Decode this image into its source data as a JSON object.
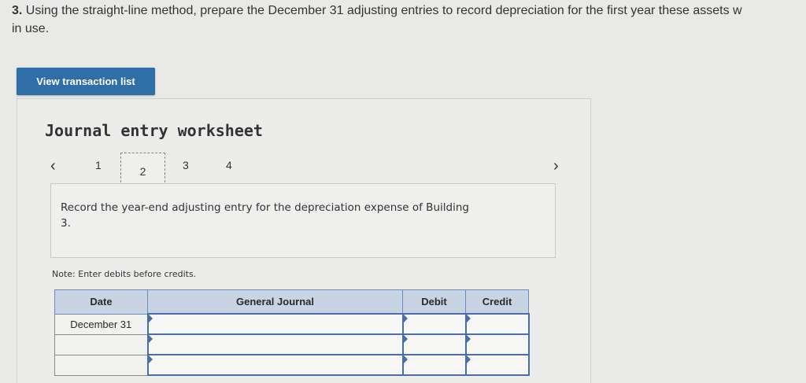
{
  "question": {
    "number": "3.",
    "text_line1": "Using the straight-line method, prepare the December 31 adjusting entries to record depreciation for the first year these assets w",
    "text_line2": "in use."
  },
  "view_button_label": "View transaction list",
  "worksheet": {
    "title": "Journal entry worksheet",
    "pages": [
      "1",
      "2",
      "3",
      "4"
    ],
    "current_page": "2",
    "instruction_line1": "Record the year-end adjusting entry for the depreciation expense of Building",
    "instruction_line2": "3.",
    "note": "Note: Enter debits before credits."
  },
  "journal": {
    "headers": [
      "Date",
      "General Journal",
      "Debit",
      "Credit"
    ],
    "rows": [
      {
        "date": "December 31",
        "account": "",
        "debit": "",
        "credit": ""
      },
      {
        "date": "",
        "account": "",
        "debit": "",
        "credit": ""
      },
      {
        "date": "",
        "account": "",
        "debit": "",
        "credit": ""
      }
    ]
  },
  "icons": {
    "prev": "chevron-left-icon",
    "next": "chevron-right-icon"
  }
}
